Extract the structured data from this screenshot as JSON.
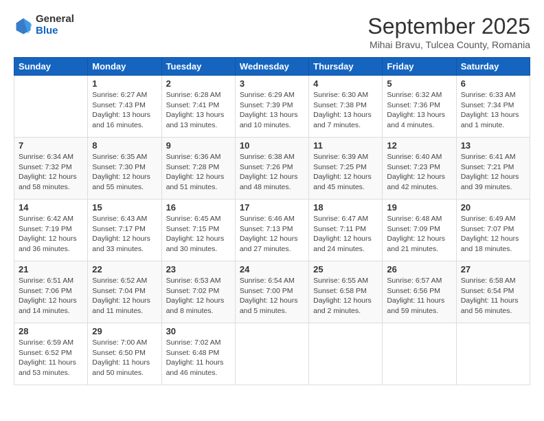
{
  "header": {
    "logo_general": "General",
    "logo_blue": "Blue",
    "month": "September 2025",
    "location": "Mihai Bravu, Tulcea County, Romania"
  },
  "days_of_week": [
    "Sunday",
    "Monday",
    "Tuesday",
    "Wednesday",
    "Thursday",
    "Friday",
    "Saturday"
  ],
  "weeks": [
    [
      {
        "day": "",
        "info": ""
      },
      {
        "day": "1",
        "info": "Sunrise: 6:27 AM\nSunset: 7:43 PM\nDaylight: 13 hours\nand 16 minutes."
      },
      {
        "day": "2",
        "info": "Sunrise: 6:28 AM\nSunset: 7:41 PM\nDaylight: 13 hours\nand 13 minutes."
      },
      {
        "day": "3",
        "info": "Sunrise: 6:29 AM\nSunset: 7:39 PM\nDaylight: 13 hours\nand 10 minutes."
      },
      {
        "day": "4",
        "info": "Sunrise: 6:30 AM\nSunset: 7:38 PM\nDaylight: 13 hours\nand 7 minutes."
      },
      {
        "day": "5",
        "info": "Sunrise: 6:32 AM\nSunset: 7:36 PM\nDaylight: 13 hours\nand 4 minutes."
      },
      {
        "day": "6",
        "info": "Sunrise: 6:33 AM\nSunset: 7:34 PM\nDaylight: 13 hours\nand 1 minute."
      }
    ],
    [
      {
        "day": "7",
        "info": "Sunrise: 6:34 AM\nSunset: 7:32 PM\nDaylight: 12 hours\nand 58 minutes."
      },
      {
        "day": "8",
        "info": "Sunrise: 6:35 AM\nSunset: 7:30 PM\nDaylight: 12 hours\nand 55 minutes."
      },
      {
        "day": "9",
        "info": "Sunrise: 6:36 AM\nSunset: 7:28 PM\nDaylight: 12 hours\nand 51 minutes."
      },
      {
        "day": "10",
        "info": "Sunrise: 6:38 AM\nSunset: 7:26 PM\nDaylight: 12 hours\nand 48 minutes."
      },
      {
        "day": "11",
        "info": "Sunrise: 6:39 AM\nSunset: 7:25 PM\nDaylight: 12 hours\nand 45 minutes."
      },
      {
        "day": "12",
        "info": "Sunrise: 6:40 AM\nSunset: 7:23 PM\nDaylight: 12 hours\nand 42 minutes."
      },
      {
        "day": "13",
        "info": "Sunrise: 6:41 AM\nSunset: 7:21 PM\nDaylight: 12 hours\nand 39 minutes."
      }
    ],
    [
      {
        "day": "14",
        "info": "Sunrise: 6:42 AM\nSunset: 7:19 PM\nDaylight: 12 hours\nand 36 minutes."
      },
      {
        "day": "15",
        "info": "Sunrise: 6:43 AM\nSunset: 7:17 PM\nDaylight: 12 hours\nand 33 minutes."
      },
      {
        "day": "16",
        "info": "Sunrise: 6:45 AM\nSunset: 7:15 PM\nDaylight: 12 hours\nand 30 minutes."
      },
      {
        "day": "17",
        "info": "Sunrise: 6:46 AM\nSunset: 7:13 PM\nDaylight: 12 hours\nand 27 minutes."
      },
      {
        "day": "18",
        "info": "Sunrise: 6:47 AM\nSunset: 7:11 PM\nDaylight: 12 hours\nand 24 minutes."
      },
      {
        "day": "19",
        "info": "Sunrise: 6:48 AM\nSunset: 7:09 PM\nDaylight: 12 hours\nand 21 minutes."
      },
      {
        "day": "20",
        "info": "Sunrise: 6:49 AM\nSunset: 7:07 PM\nDaylight: 12 hours\nand 18 minutes."
      }
    ],
    [
      {
        "day": "21",
        "info": "Sunrise: 6:51 AM\nSunset: 7:06 PM\nDaylight: 12 hours\nand 14 minutes."
      },
      {
        "day": "22",
        "info": "Sunrise: 6:52 AM\nSunset: 7:04 PM\nDaylight: 12 hours\nand 11 minutes."
      },
      {
        "day": "23",
        "info": "Sunrise: 6:53 AM\nSunset: 7:02 PM\nDaylight: 12 hours\nand 8 minutes."
      },
      {
        "day": "24",
        "info": "Sunrise: 6:54 AM\nSunset: 7:00 PM\nDaylight: 12 hours\nand 5 minutes."
      },
      {
        "day": "25",
        "info": "Sunrise: 6:55 AM\nSunset: 6:58 PM\nDaylight: 12 hours\nand 2 minutes."
      },
      {
        "day": "26",
        "info": "Sunrise: 6:57 AM\nSunset: 6:56 PM\nDaylight: 11 hours\nand 59 minutes."
      },
      {
        "day": "27",
        "info": "Sunrise: 6:58 AM\nSunset: 6:54 PM\nDaylight: 11 hours\nand 56 minutes."
      }
    ],
    [
      {
        "day": "28",
        "info": "Sunrise: 6:59 AM\nSunset: 6:52 PM\nDaylight: 11 hours\nand 53 minutes."
      },
      {
        "day": "29",
        "info": "Sunrise: 7:00 AM\nSunset: 6:50 PM\nDaylight: 11 hours\nand 50 minutes."
      },
      {
        "day": "30",
        "info": "Sunrise: 7:02 AM\nSunset: 6:48 PM\nDaylight: 11 hours\nand 46 minutes."
      },
      {
        "day": "",
        "info": ""
      },
      {
        "day": "",
        "info": ""
      },
      {
        "day": "",
        "info": ""
      },
      {
        "day": "",
        "info": ""
      }
    ]
  ]
}
